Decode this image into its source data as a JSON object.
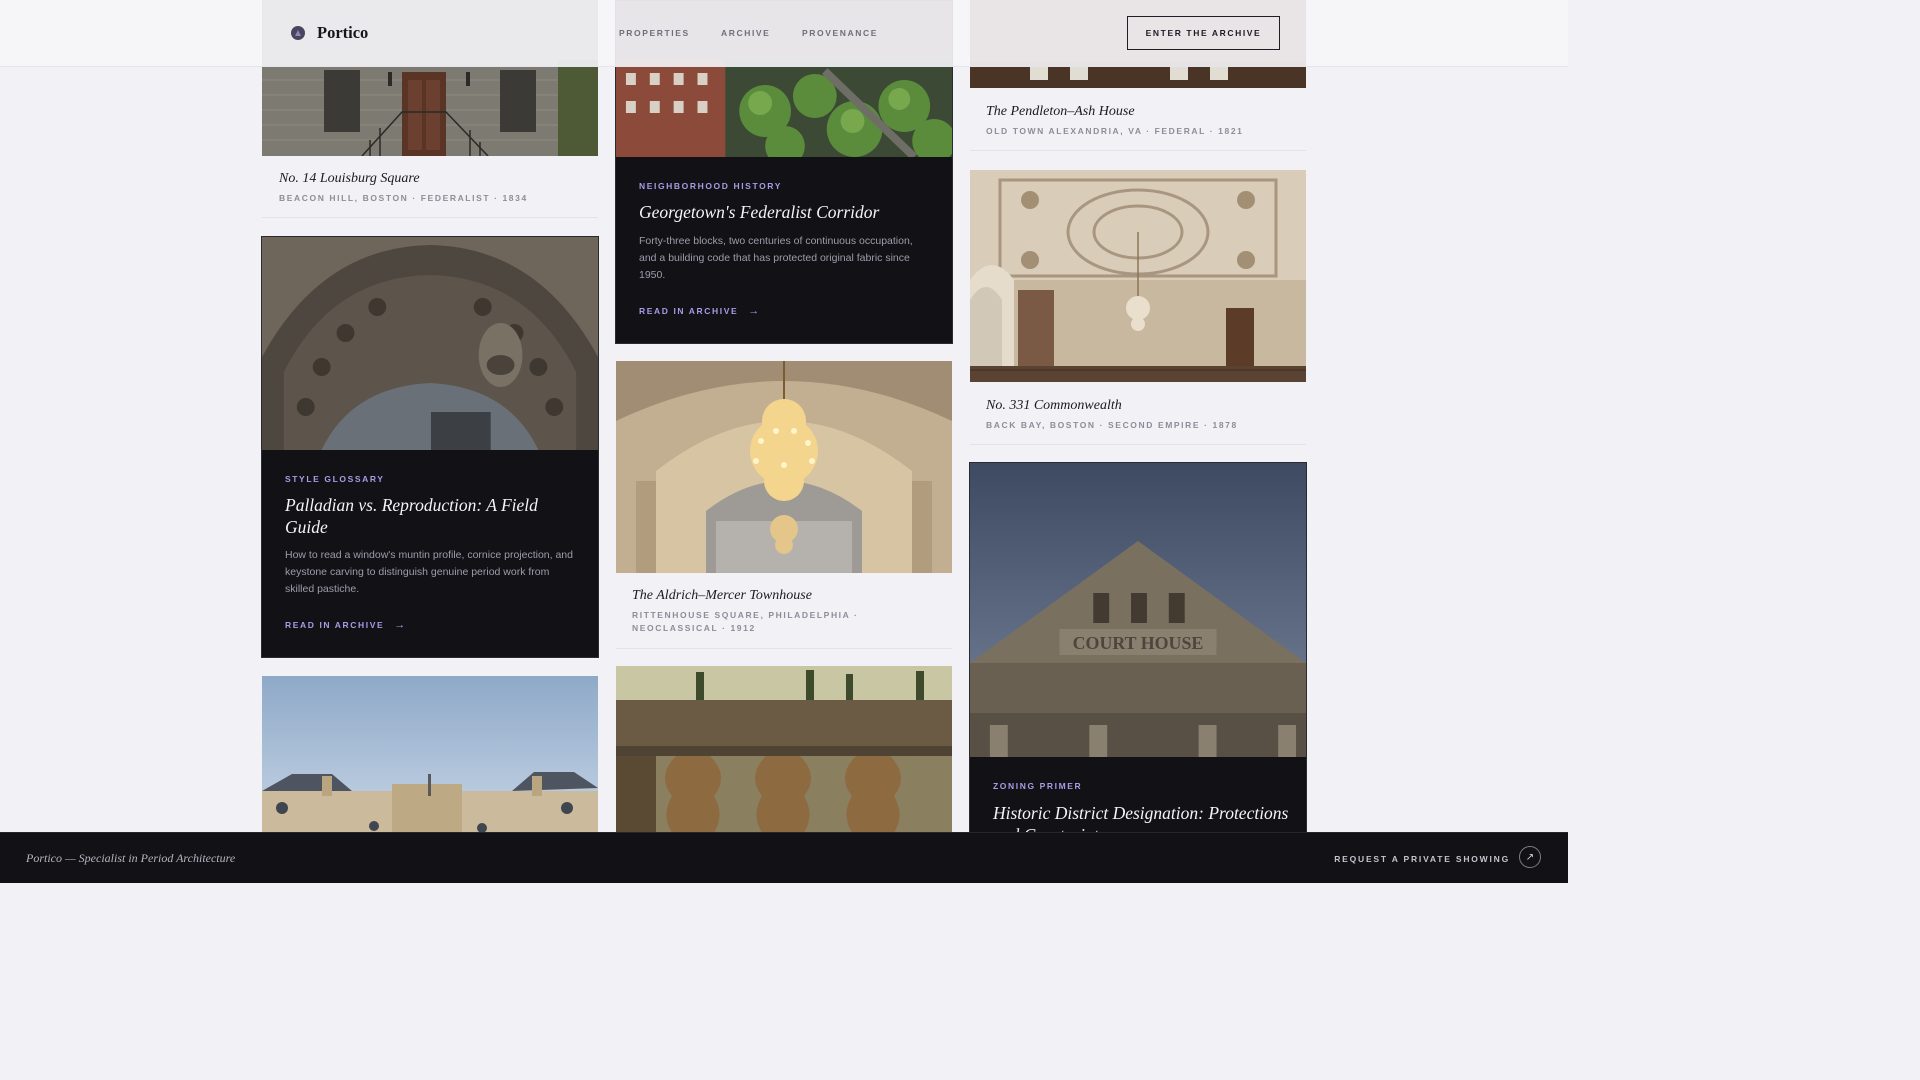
{
  "brand": {
    "name": "Portico",
    "logo_icon": "portico-logo-icon"
  },
  "nav": [
    {
      "label": "PROPERTIES"
    },
    {
      "label": "ARCHIVE"
    },
    {
      "label": "PROVENANCE"
    }
  ],
  "header": {
    "cta_label": "ENTER THE ARCHIVE"
  },
  "properties": {
    "louisburg": {
      "title": "No. 14 Louisburg Square",
      "meta": "BEACON HILL, BOSTON · FEDERALIST · 1834"
    },
    "pendleton": {
      "title": "The Pendleton–Ash House",
      "meta": "OLD TOWN ALEXANDRIA, VA · FEDERAL · 1821"
    },
    "commonwealth": {
      "title": "No. 331 Commonwealth",
      "meta": "BACK BAY, BOSTON · SECOND EMPIRE · 1878"
    },
    "aldrich": {
      "title": "The Aldrich–Mercer Townhouse",
      "meta_line1": "RITTENHOUSE SQUARE, PHILADELPHIA ·",
      "meta_line2": "NEOCLASSICAL · 1912"
    }
  },
  "articles": {
    "georgetown": {
      "kicker": "NEIGHBORHOOD HISTORY",
      "title": "Georgetown's Federalist Corridor",
      "body": "Forty-three blocks, two centuries of continuous occupation, and a building code that has protected original fabric since 1950.",
      "link": "READ IN ARCHIVE",
      "link_icon": "arrow-right-icon"
    },
    "palladian": {
      "kicker": "STYLE GLOSSARY",
      "title": "Palladian vs. Reproduction: A Field Guide",
      "body": "How to read a window's muntin profile, cornice projection, and keystone carving to distinguish genuine period work from skilled pastiche.",
      "link": "READ IN ARCHIVE",
      "link_icon": "arrow-right-icon"
    },
    "zoning": {
      "kicker": "ZONING PRIMER",
      "title": "Historic District Designation: Protections and Constraints"
    }
  },
  "photo_text": {
    "courthouse": "COURT HOUSE"
  },
  "footer": {
    "tagline": "Portico — Specialist in Period Architecture",
    "cta": "REQUEST A PRIVATE SHOWING",
    "cta_icon": "arrow-up-right-icon"
  },
  "colors": {
    "accent": "#a99be6",
    "dark_card": "#111116",
    "page_bg": "#f1f1f6"
  }
}
